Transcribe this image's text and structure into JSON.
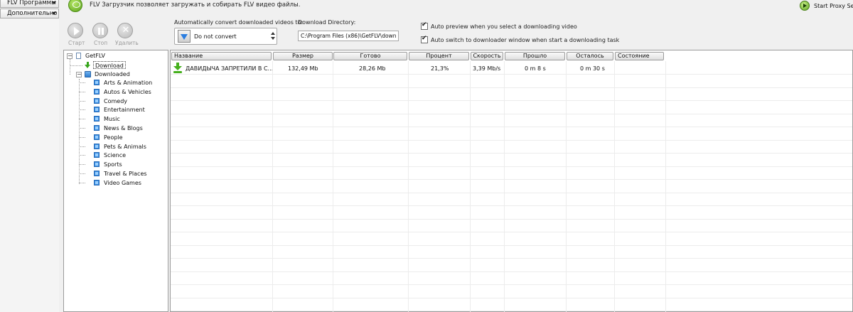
{
  "menu": {
    "programs": "FLV Программы",
    "extra": "Дополнительно"
  },
  "header": {
    "note": "FLV Загрузчик позволяет загружать и собирать FLV видео файлы."
  },
  "toolbar": {
    "start": "Старт",
    "stop": "Стоп",
    "delete": "Удалить"
  },
  "options": {
    "convert_label": "Automatically convert downloaded videos to:",
    "convert_value": "Do not convert",
    "dir_label": "Download Directory:",
    "dir_value": "C:\\Program Files (x86)\\GetFLV\\down",
    "auto_preview": "Auto preview when you select a downloading video",
    "auto_switch": "Auto switch to downloader window when start a downloading task",
    "auto_preview_checked": true,
    "auto_switch_checked": true
  },
  "proxy": {
    "label": "Start Proxy Serv"
  },
  "tree": {
    "root": "GetFLV",
    "download": "Download",
    "downloaded": "Downloaded",
    "categories": [
      "Arts & Animation",
      "Autos & Vehicles",
      "Comedy",
      "Entertainment",
      "Music",
      "News & Blogs",
      "People",
      "Pets & Animals",
      "Science",
      "Sports",
      "Travel & Places",
      "Video Games"
    ]
  },
  "table": {
    "headers": [
      "Название",
      "Размер",
      "Готово",
      "Процент",
      "Скорость",
      "Прошло",
      "Осталось",
      "Состояние"
    ],
    "rows": [
      {
        "name": "ДАВИДЫЧА ЗАПРЕТИЛИ В С...",
        "size": "132,49 Mb",
        "done": "28,26 Mb",
        "percent": "21,3%",
        "speed": "3,39 Mb/s",
        "elapsed": "0 m 8 s",
        "remaining": "0 m 30 s",
        "state": ""
      }
    ]
  },
  "colors": {
    "accent_green": "#46b01e",
    "folder_blue": "#3a8ce0"
  }
}
